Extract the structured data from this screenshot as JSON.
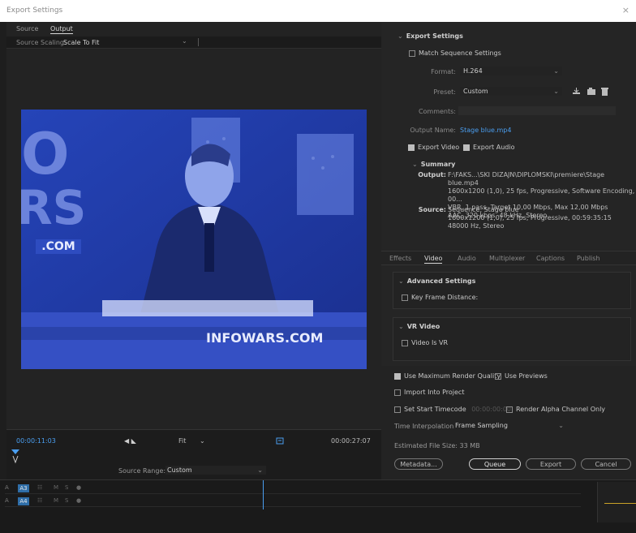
{
  "window": {
    "title": "Export Settings",
    "close_glyph": "×"
  },
  "left_tabs": {
    "source": "Source",
    "output": "Output"
  },
  "source_scaling": {
    "label": "Source Scaling:",
    "value": "Scale To Fit"
  },
  "video_overlay": {
    "big_letters": [
      "O",
      "RS"
    ],
    "dot_com_left": ".COM",
    "lower_third": "INFOWARS.COM"
  },
  "export_settings": {
    "header": "Export Settings",
    "match_sequence": "Match Sequence Settings",
    "format_label": "Format:",
    "format_value": "H.264",
    "preset_label": "Preset:",
    "preset_value": "Custom",
    "comments_label": "Comments:",
    "output_name_label": "Output Name:",
    "output_name_value": "Stage blue.mp4",
    "export_video": "Export Video",
    "export_audio": "Export Audio"
  },
  "summary": {
    "header": "Summary",
    "output_label": "Output:",
    "output_lines": [
      "F:\\FAKS...\\SKI DIZAJN\\DIPLOMSKI\\premiere\\Stage blue.mp4",
      "1600x1200 (1,0), 25 fps, Progressive, Software Encoding, 00...",
      "VBR, 1 pass, Target 10,00 Mbps, Max 12,00 Mbps",
      "AAC, 320 kbps, 48 kHz, Stereo"
    ],
    "source_label": "Source:",
    "source_lines": [
      "Sequence, Stage blue",
      "1600x1200 (1,0), 25 fps, Progressive, 00:59:35:15",
      "48000 Hz, Stereo"
    ]
  },
  "sub_tabs": [
    "Effects",
    "Video",
    "Audio",
    "Multiplexer",
    "Captions",
    "Publish"
  ],
  "advanced": {
    "header": "Advanced Settings",
    "key_frame": "Key Frame Distance:"
  },
  "vr": {
    "header": "VR Video",
    "video_is_vr": "Video Is VR"
  },
  "render": {
    "max_quality": "Use Maximum Render Quality",
    "use_previews": "Use Previews",
    "import_project": "Import Into Project",
    "set_start_tc": "Set Start Timecode",
    "start_tc_value": "00:00:00:00",
    "render_alpha": "Render Alpha Channel Only",
    "time_interp_label": "Time Interpolation:",
    "time_interp_value": "Frame Sampling",
    "est_size": "Estimated File Size:  33 MB"
  },
  "buttons": {
    "metadata": "Metadata...",
    "queue": "Queue",
    "export": "Export",
    "cancel": "Cancel"
  },
  "transport": {
    "timecode_in": "00:00:11:03",
    "fit": "Fit",
    "timecode_out": "00:00:27:07",
    "source_range_label": "Source Range:",
    "source_range_value": "Custom"
  },
  "tracks": [
    {
      "label": "A3"
    },
    {
      "label": "A4"
    }
  ],
  "colors": {
    "accent": "#4a9ef0",
    "video_tint": "#1f3aa8"
  }
}
